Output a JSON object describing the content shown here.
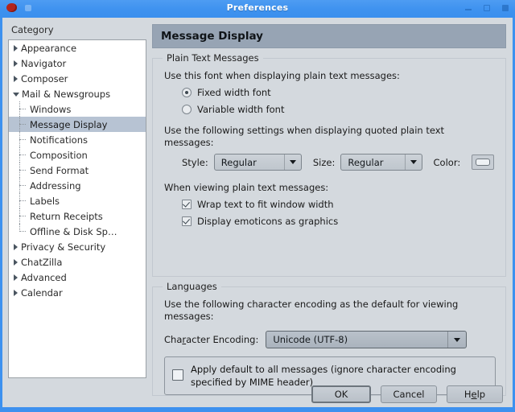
{
  "window": {
    "title": "Preferences",
    "app_icon": "mozilla-icon",
    "controls": [
      {
        "name": "minimize-button",
        "icon": "minimize-icon"
      },
      {
        "name": "maximize-button",
        "icon": "maximize-icon"
      },
      {
        "name": "close-button",
        "icon": "close-icon"
      }
    ]
  },
  "sidebar": {
    "label": "Category",
    "items": [
      {
        "label": "Appearance",
        "level": 0,
        "state": "collapsed",
        "selected": false
      },
      {
        "label": "Navigator",
        "level": 0,
        "state": "collapsed",
        "selected": false
      },
      {
        "label": "Composer",
        "level": 0,
        "state": "collapsed",
        "selected": false
      },
      {
        "label": "Mail & Newsgroups",
        "level": 0,
        "state": "expanded",
        "selected": false
      },
      {
        "label": "Windows",
        "level": 1,
        "state": "leaf",
        "selected": false
      },
      {
        "label": "Message Display",
        "level": 1,
        "state": "leaf",
        "selected": true
      },
      {
        "label": "Notifications",
        "level": 1,
        "state": "leaf",
        "selected": false
      },
      {
        "label": "Composition",
        "level": 1,
        "state": "leaf",
        "selected": false
      },
      {
        "label": "Send Format",
        "level": 1,
        "state": "leaf",
        "selected": false
      },
      {
        "label": "Addressing",
        "level": 1,
        "state": "leaf",
        "selected": false
      },
      {
        "label": "Labels",
        "level": 1,
        "state": "leaf",
        "selected": false
      },
      {
        "label": "Return Receipts",
        "level": 1,
        "state": "leaf",
        "selected": false
      },
      {
        "label": "Offline & Disk Sp…",
        "level": 1,
        "state": "leaf",
        "selected": false,
        "last": true
      },
      {
        "label": "Privacy & Security",
        "level": 0,
        "state": "collapsed",
        "selected": false
      },
      {
        "label": "ChatZilla",
        "level": 0,
        "state": "collapsed",
        "selected": false
      },
      {
        "label": "Advanced",
        "level": 0,
        "state": "collapsed",
        "selected": false
      },
      {
        "label": "Calendar",
        "level": 0,
        "state": "collapsed",
        "selected": false
      }
    ]
  },
  "panel": {
    "header": "Message Display",
    "plain_text": {
      "group_title": "Plain Text Messages",
      "font_prompt": "Use this font when displaying plain text messages:",
      "radios": [
        {
          "label": "Fixed width font",
          "checked": true
        },
        {
          "label": "Variable width font",
          "checked": false
        }
      ],
      "quoted_prompt": "Use the following settings when displaying quoted plain text messages:",
      "style_label": "Style:",
      "style_value": "Regular",
      "size_label": "Size:",
      "size_value": "Regular",
      "color_label": "Color:",
      "color_value": "#eef1f4",
      "viewing_prompt": "When viewing plain text messages:",
      "checkboxes": [
        {
          "label": "Wrap text to fit window width",
          "checked": true
        },
        {
          "label": "Display emoticons as graphics",
          "checked": true
        }
      ]
    },
    "languages": {
      "group_title": "Languages",
      "prompt": "Use the following character encoding as the default for viewing messages:",
      "encoding_label_pre": "Cha",
      "encoding_label_accel": "r",
      "encoding_label_post": "acter Encoding:",
      "encoding_value": "Unicode (UTF-8)",
      "apply_default": {
        "line1": "Apply default to all messages (ignore character encoding",
        "line2": "specified by MIME header)",
        "checked": false
      }
    }
  },
  "buttons": {
    "ok": "OK",
    "cancel": "Cancel",
    "help_pre": "H",
    "help_accel": "e",
    "help_post": "lp"
  }
}
